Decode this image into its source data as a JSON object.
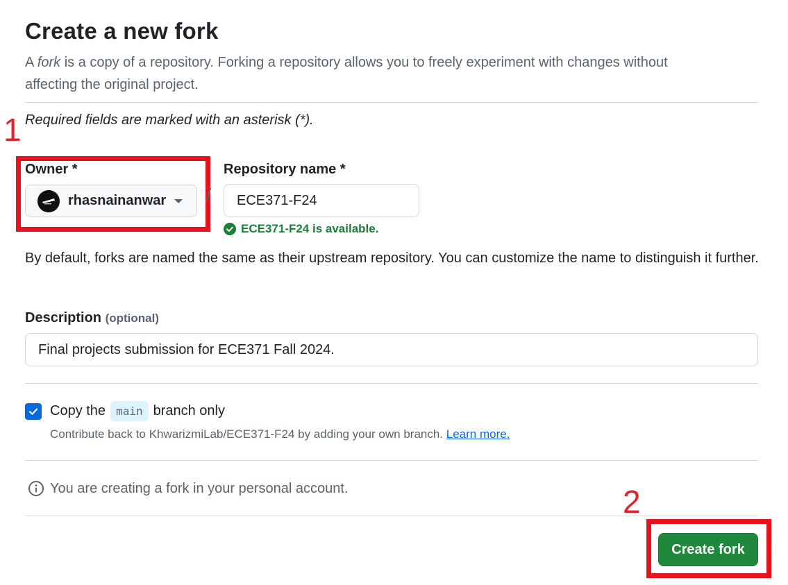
{
  "page": {
    "title": "Create a new fork",
    "intro_prefix": "A ",
    "intro_em": "fork",
    "intro_suffix": " is a copy of a repository. Forking a repository allows you to freely experiment with changes without affecting the original project.",
    "required_note": "Required fields are marked with an asterisk (*)."
  },
  "owner": {
    "label": "Owner *",
    "value": "rhasnainanwar",
    "avatar_icon": "avatar-image"
  },
  "separator": "/",
  "repo": {
    "label": "Repository name *",
    "value": "ECE371-F24",
    "availability": "ECE371-F24 is available.",
    "availability_icon": "check-circle-fill-icon"
  },
  "naming_note": "By default, forks are named the same as their upstream repository. You can customize the name to distinguish it further.",
  "description": {
    "label": "Description",
    "optional": "(optional)",
    "value": "Final projects submission for ECE371 Fall 2024."
  },
  "copy_branch": {
    "checked": true,
    "prefix": "Copy the",
    "branch": "main",
    "suffix": "branch only",
    "hint": "Contribute back to KhwarizmiLab/ECE371-F24 by adding your own branch.",
    "learn_more": "Learn more."
  },
  "info": {
    "icon": "info-icon",
    "text": "You are creating a fork in your personal account."
  },
  "submit": {
    "label": "Create fork"
  },
  "annotations": {
    "step1": "1",
    "step2": "2",
    "color": "#e8121f"
  },
  "colors": {
    "primary_button": "#1f883d",
    "success": "#1a7f37",
    "link": "#0969da",
    "muted": "#59636e"
  }
}
